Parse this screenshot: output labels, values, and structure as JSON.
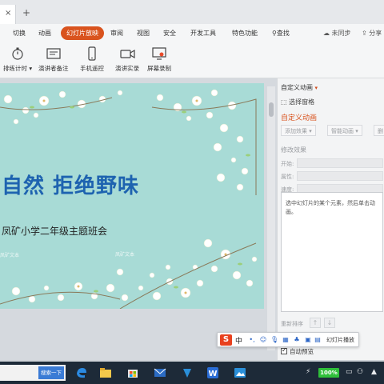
{
  "tabs": {
    "close_glyph": "×",
    "new_tab_glyph": "+"
  },
  "menu": {
    "items": [
      "切换",
      "动画",
      "幻灯片放映",
      "审阅",
      "视图",
      "安全",
      "开发工具",
      "特色功能"
    ],
    "active": "幻灯片放映",
    "search_label": "查找",
    "sync_label": "未同步",
    "share_label": "分享"
  },
  "toolbar": {
    "tools": [
      {
        "label": "排练计时 ▾",
        "icon": "stopwatch-icon"
      },
      {
        "label": "演讲者备注",
        "icon": "notes-icon"
      },
      {
        "label": "手机遥控",
        "icon": "phone-icon"
      },
      {
        "label": "演讲实录",
        "icon": "video-camera-icon"
      },
      {
        "label": "屏幕录制",
        "icon": "screen-record-icon"
      }
    ]
  },
  "slide": {
    "title": "自然  拒绝野味",
    "subtitle": "凤矿小学二年级主题班会",
    "watermark_left": "凤矿文本",
    "watermark_center": "凤矿文本"
  },
  "pane": {
    "title": "自定义动画",
    "title_caret": "▾",
    "select_pane": "选择窗格",
    "heading": "自定义动画",
    "add_effect": "添加效果 ▾",
    "smart_anim": "智能动画 ▾",
    "delete": "删",
    "modify_heading": "修改效果",
    "fields": [
      "开始:",
      "属性:",
      "速度:"
    ],
    "hint": "选中幻灯片的某个元素，然后单击动画。",
    "reorder_label": "重新排序",
    "up_arrow": "↑",
    "down_arrow": "↓",
    "auto_preview": "自动预览"
  },
  "ime": {
    "logo": "S",
    "mode": "中",
    "label": "幻灯片播放"
  },
  "taskbar": {
    "search_button": "搜索一下",
    "battery": "100%"
  },
  "colors": {
    "accent": "#d9531e",
    "slide_bg": "#a8dbd6",
    "title_blue": "#1e63b0",
    "taskbar": "#1d2a38"
  }
}
